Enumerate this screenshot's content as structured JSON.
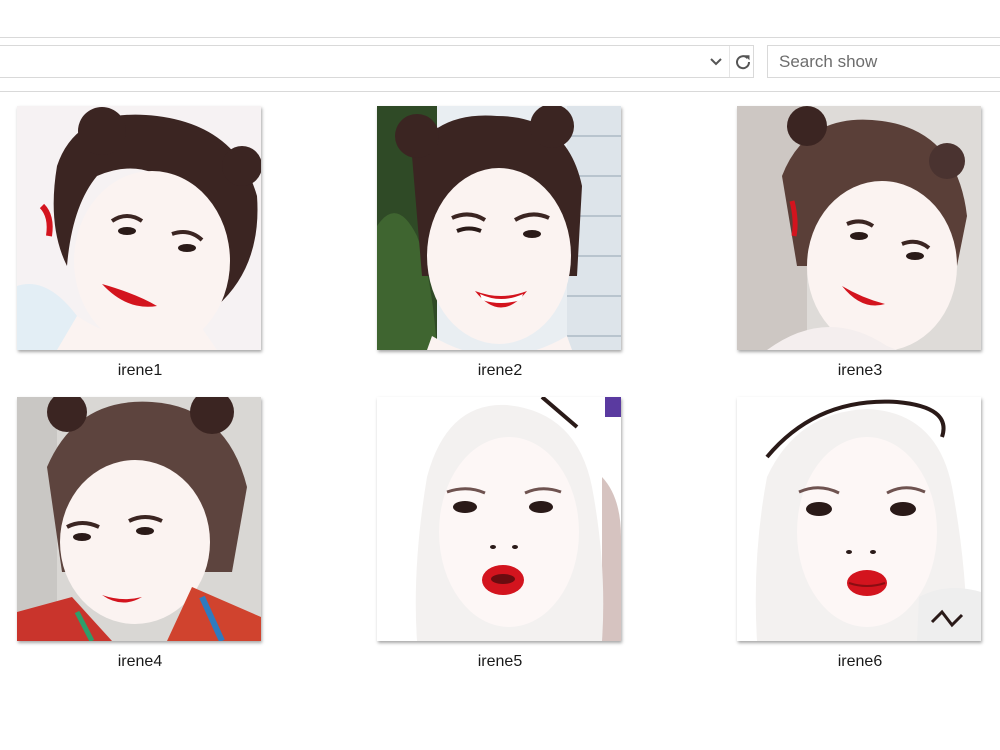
{
  "toolbar": {
    "search": {
      "placeholder": "Search show",
      "value": ""
    },
    "dropdown_icon": "chevron-down-icon",
    "refresh_icon": "refresh-icon"
  },
  "files": [
    {
      "name": "irene1",
      "icon": "image-thumbnail"
    },
    {
      "name": "irene2",
      "icon": "image-thumbnail"
    },
    {
      "name": "irene3",
      "icon": "image-thumbnail"
    },
    {
      "name": "irene4",
      "icon": "image-thumbnail"
    },
    {
      "name": "irene5",
      "icon": "image-thumbnail"
    },
    {
      "name": "irene6",
      "icon": "image-thumbnail"
    }
  ],
  "colors": {
    "border": "#d9d9d9",
    "placeholder": "#6d6d6d",
    "lip_red": "#d3141e",
    "hair_dark": "#3b2522",
    "hair_white": "#f3f1f0"
  }
}
